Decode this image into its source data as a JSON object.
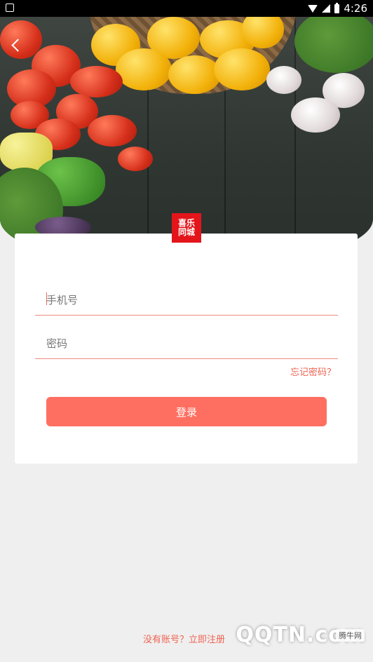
{
  "status_bar": {
    "time": "4:26"
  },
  "login_card": {
    "phone_placeholder": "手机号",
    "password_placeholder": "密码",
    "forgot_label": "忘记密码？",
    "login_label": "登录"
  },
  "footer": {
    "register_label": "没有账号？立即注册"
  },
  "logo": {
    "line1": "喜乐",
    "line2": "同城"
  },
  "watermark": {
    "text": "QQTN.com",
    "badge": "腾牛网"
  },
  "colors": {
    "accent": "#ff6f61",
    "logo_red": "#e3151b"
  }
}
